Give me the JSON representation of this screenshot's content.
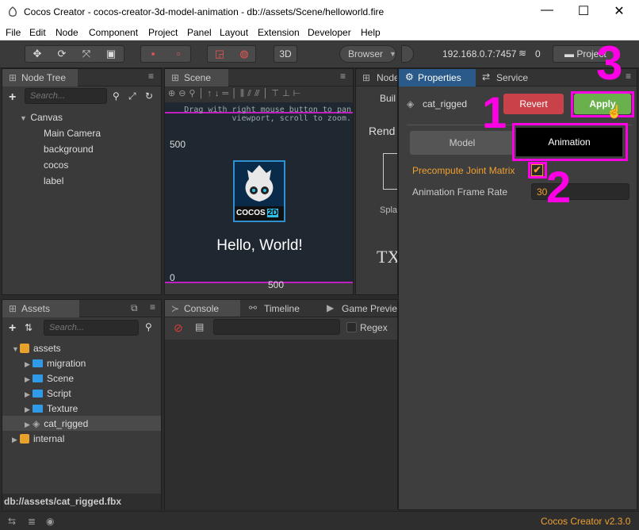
{
  "window": {
    "title": "Cocos Creator - cocos-creator-3d-model-animation - db://assets/Scene/helloworld.fire",
    "minimize": "—",
    "maximize": "☐",
    "close": "✕"
  },
  "menu": [
    "File",
    "Edit",
    "Node",
    "Component",
    "Project",
    "Panel",
    "Layout",
    "Extension",
    "Developer",
    "Help"
  ],
  "toolbar": {
    "btn_3d": "3D",
    "browser": "Browser",
    "ip": "192.168.0.7:7457",
    "count": "0",
    "project": "Project"
  },
  "node_tree": {
    "title": "Node Tree",
    "search_placeholder": "Search...",
    "items": [
      "Canvas",
      "Main Camera",
      "background",
      "cocos",
      "label"
    ]
  },
  "scene": {
    "title": "Scene",
    "hint": "Drag with right mouse button to pan\nviewport, scroll to zoom.",
    "y_top": "500",
    "y_bottom": "0",
    "x_right": "500",
    "logo_text": "COCOS",
    "logo_badge": "2D",
    "hello": "Hello, World!"
  },
  "node_lib": {
    "title": "Node",
    "items": [
      "Buil",
      "Rend",
      "Spla",
      "TX"
    ]
  },
  "properties": {
    "title": "Properties",
    "service": "Service",
    "asset_name": "cat_rigged",
    "revert": "Revert",
    "apply": "Apply",
    "tab_model": "Model",
    "tab_animation": "Animation",
    "precompute_label": "Precompute Joint Matrix",
    "frame_rate_label": "Animation Frame Rate",
    "frame_rate_value": "30"
  },
  "assets": {
    "title": "Assets",
    "search_placeholder": "Search...",
    "items": [
      {
        "label": "assets",
        "depth": 0,
        "type": "db"
      },
      {
        "label": "migration",
        "depth": 1,
        "type": "folder"
      },
      {
        "label": "Scene",
        "depth": 1,
        "type": "folder"
      },
      {
        "label": "Script",
        "depth": 1,
        "type": "folder"
      },
      {
        "label": "Texture",
        "depth": 1,
        "type": "folder"
      },
      {
        "label": "cat_rigged",
        "depth": 1,
        "type": "model"
      },
      {
        "label": "internal",
        "depth": 0,
        "type": "db"
      }
    ],
    "path": "db://assets/cat_rigged.fbx"
  },
  "console": {
    "title": "Console",
    "timeline": "Timeline",
    "game_preview": "Game Previe",
    "regex": "Regex"
  },
  "status": {
    "version": "Cocos Creator v2.3.0"
  },
  "annotations": {
    "one": "1",
    "two": "2",
    "three": "3"
  },
  "colors": {
    "accent_orange": "#f0a030",
    "magenta": "#ff00e6",
    "apply_green": "#6ab04c",
    "revert_red": "#c9424a",
    "selected_blue": "#2a5a8a"
  }
}
